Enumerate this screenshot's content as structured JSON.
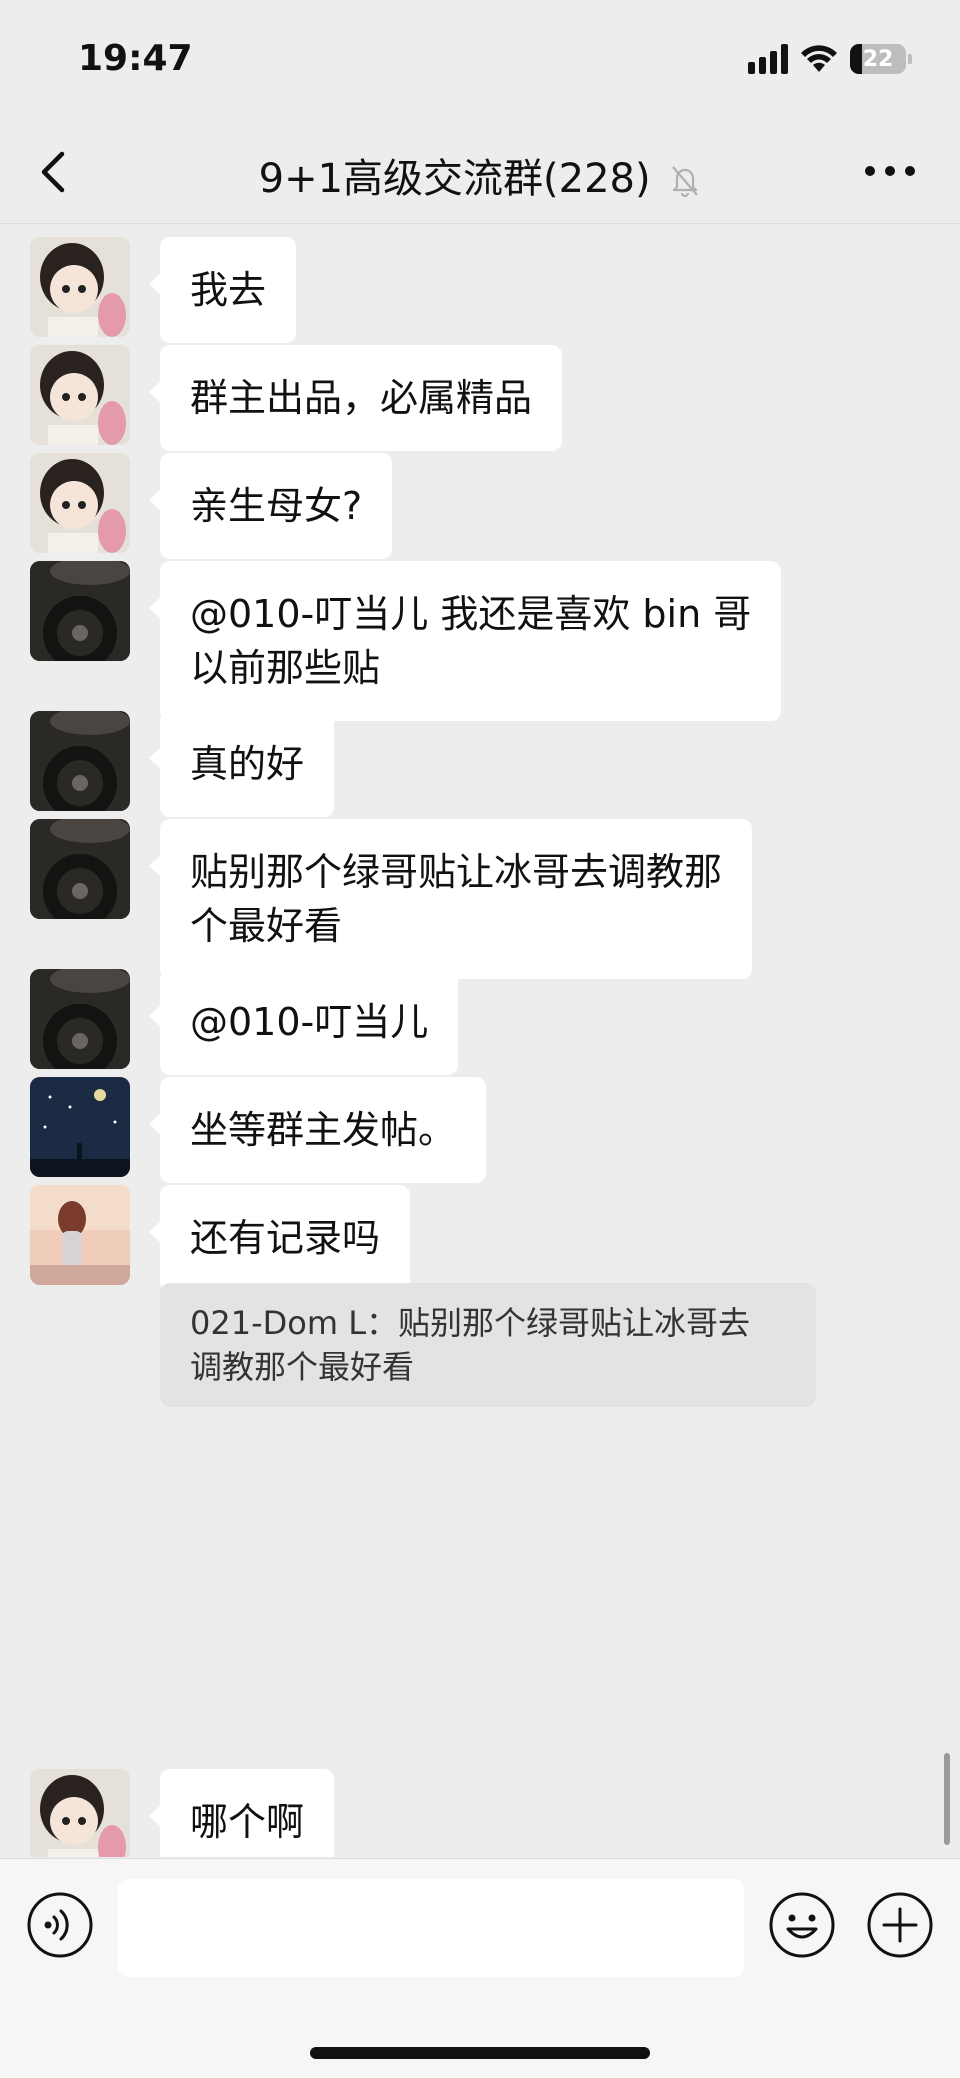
{
  "status": {
    "time": "19:47",
    "battery": "22"
  },
  "nav": {
    "title": "9+1高级交流群(228)"
  },
  "messages": [
    {
      "avatar": "girl-cartoon-avatar",
      "lines": [
        "我去"
      ]
    },
    {
      "avatar": "girl-cartoon-avatar",
      "lines": [
        "群主出品，必属精品"
      ]
    },
    {
      "avatar": "girl-cartoon-avatar",
      "lines": [
        "亲生母女?"
      ]
    },
    {
      "avatar": "car-interior-avatar",
      "lines": [
        "@010-叮当儿 我还是喜欢 bin 哥",
        "以前那些贴"
      ]
    },
    {
      "avatar": "car-interior-avatar",
      "lines": [
        "真的好"
      ]
    },
    {
      "avatar": "car-interior-avatar",
      "lines": [
        "贴别那个绿哥贴让冰哥去调教那",
        "个最好看"
      ]
    },
    {
      "avatar": "car-interior-avatar",
      "lines": [
        "@010-叮当儿"
      ]
    },
    {
      "avatar": "starry-night-avatar",
      "lines": [
        "坐等群主发帖。"
      ]
    },
    {
      "avatar": "sunset-girl-avatar",
      "lines": [
        "还有记录吗"
      ],
      "quote": [
        "021-Dom L：贴别那个绿哥贴让冰哥去",
        "调教那个最好看"
      ]
    },
    {
      "avatar": "girl-cartoon-avatar",
      "lines": [
        "哪个啊"
      ]
    }
  ],
  "input": {
    "placeholder": ""
  },
  "icons": {
    "back": "chevron-left-icon",
    "mute": "bell-slash-icon",
    "more": "more-dots-icon",
    "voice": "voice-icon",
    "emoji": "emoji-icon",
    "plus": "plus-icon"
  }
}
